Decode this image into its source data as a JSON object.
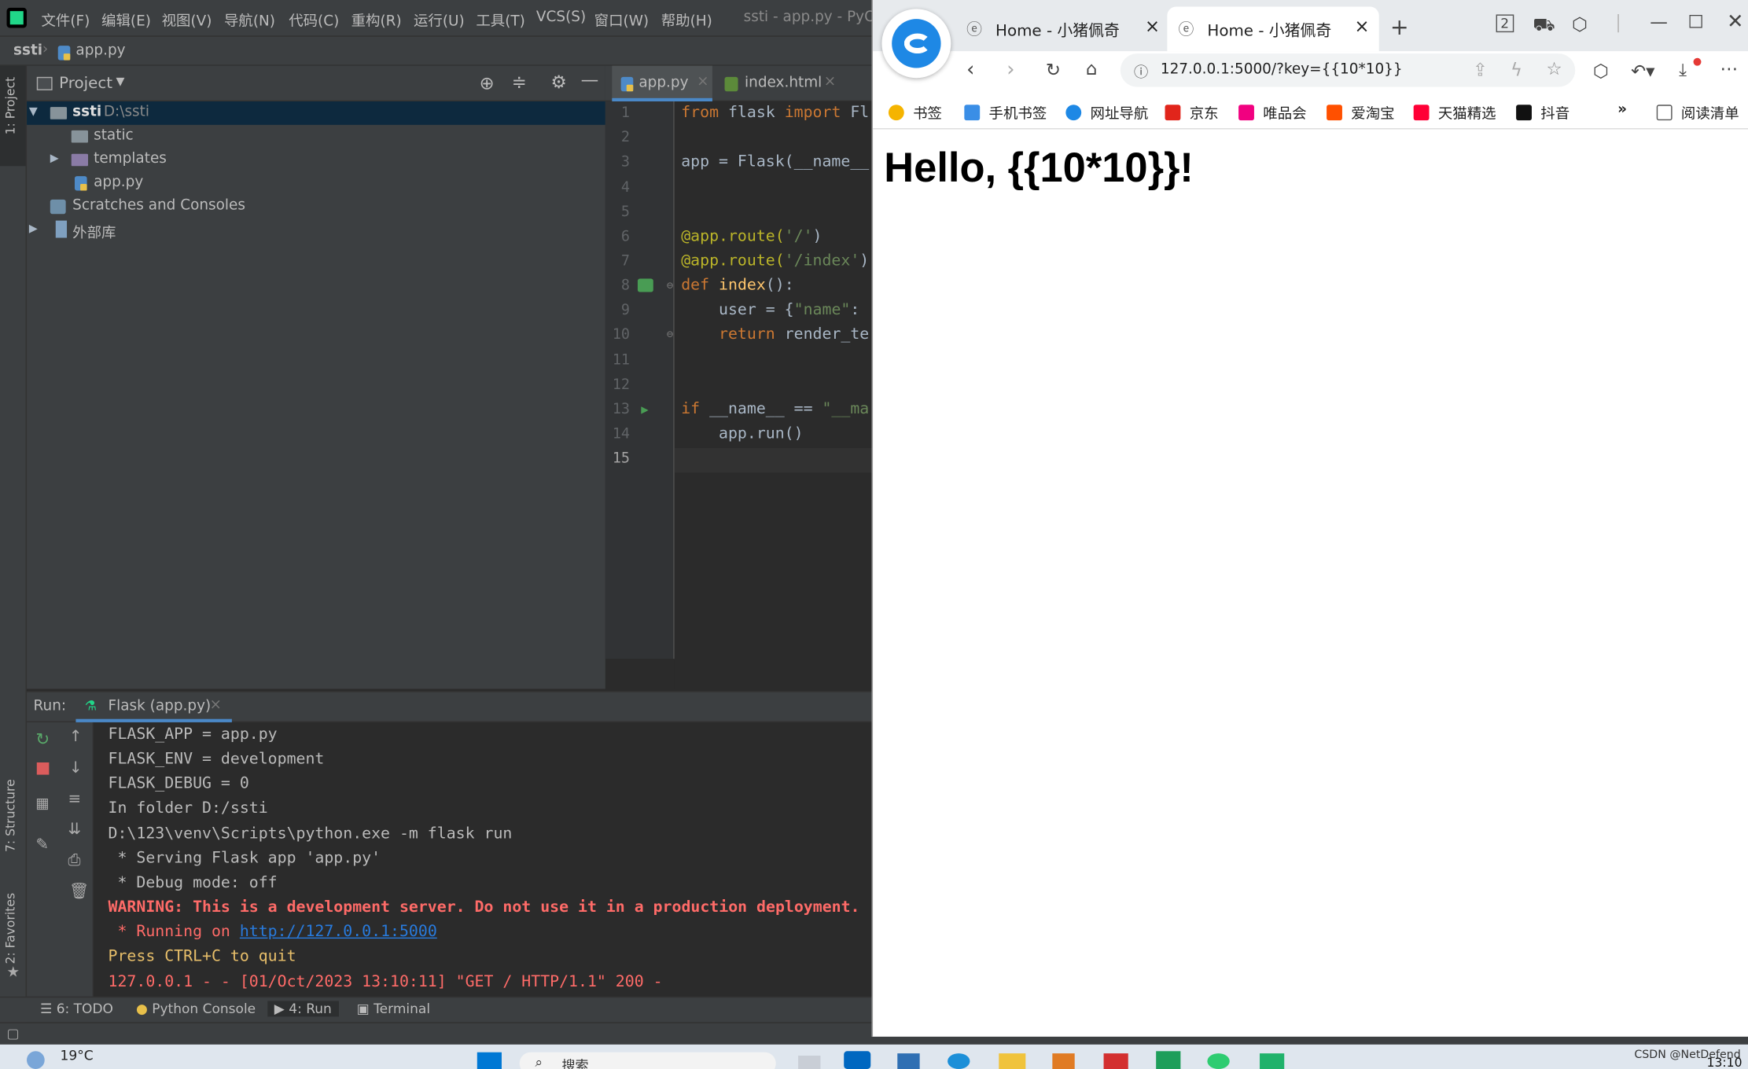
{
  "ide": {
    "menu": [
      "文件(F)",
      "编辑(E)",
      "视图(V)",
      "导航(N)",
      "代码(C)",
      "重构(R)",
      "运行(U)",
      "工具(T)",
      "VCS(S)",
      "窗口(W)",
      "帮助(H)"
    ],
    "window_title": "ssti - app.py - PyC",
    "breadcrumb": {
      "project": "ssti",
      "file": "app.py"
    },
    "left_strip": {
      "project": "1: Project",
      "structure": "7: Structure",
      "favorites": "2: Favorites"
    },
    "project_panel": {
      "title": "Project",
      "root": {
        "name": "ssti",
        "path": "D:\\ssti"
      },
      "items": [
        "static",
        "templates",
        "app.py"
      ],
      "scratches": "Scratches and Consoles",
      "external": "外部库"
    },
    "editor_tabs": [
      "app.py",
      "index.html"
    ],
    "line_numbers": [
      "1",
      "2",
      "3",
      "4",
      "5",
      "6",
      "7",
      "8",
      "9",
      "10",
      "11",
      "12",
      "13",
      "14",
      "15"
    ],
    "code": {
      "l1_kw": "from",
      "l1_mid": " flask ",
      "l1_kw2": "import",
      "l1_rest": " Fl",
      "l3": "app = Flask(__name__",
      "l6_dec": "@app.route(",
      "l6_str": "'/'",
      "l6_end": ")",
      "l7_dec": "@app.route(",
      "l7_str": "'/index'",
      "l7_end": ")",
      "l8_kw": "def",
      "l8_fn": " index",
      "l8_end": "():",
      "l9_a": "    user = {",
      "l9_str": "\"name\"",
      "l9_b": ":",
      "l10_kw": "    return",
      "l10_rest": " render_te",
      "l13_kw": "if",
      "l13_mid": " __name__ == ",
      "l13_str": "\"__ma",
      "l14": "    app.run()"
    },
    "run": {
      "label": "Run:",
      "config": "Flask (app.py)",
      "lines": [
        "FLASK_APP = app.py",
        "FLASK_ENV = development",
        "FLASK_DEBUG = 0",
        "In folder D:/ssti",
        "D:\\123\\venv\\Scripts\\python.exe -m flask run",
        " * Serving Flask app 'app.py'",
        " * Debug mode: off"
      ],
      "warning": "WARNING: This is a development server. Do not use it in a production deployment.",
      "running_prefix": " * Running on ",
      "running_url": "http://127.0.0.1:5000",
      "quit": "Press CTRL+C to quit",
      "log": "127.0.0.1 - - [01/Oct/2023 13:10:11] \"GET / HTTP/1.1\" 200 -"
    },
    "bottom_tabs": [
      "6: TODO",
      "Python Console",
      "4: Run",
      "Terminal"
    ]
  },
  "browser": {
    "tabs": [
      "Home - 小猪佩奇",
      "Home - 小猪佩奇"
    ],
    "address": "127.0.0.1:5000/?key={{10*10}}",
    "bookmarks": [
      "书签",
      "手机书签",
      "网址导航",
      "京东",
      "唯品会",
      "爱淘宝",
      "天猫精选",
      "抖音"
    ],
    "reading_list": "阅读清单",
    "page_heading": "Hello, {{10*10}}!",
    "colors": {
      "heading": "#000000",
      "jd": "#e1251b",
      "vip": "#f10180",
      "taobao": "#ff5000",
      "tmall": "#ff0036"
    }
  },
  "taskbar": {
    "weather": "19°C",
    "search": "搜索",
    "watermark": "CSDN @NetDefend",
    "time": "13:10"
  }
}
